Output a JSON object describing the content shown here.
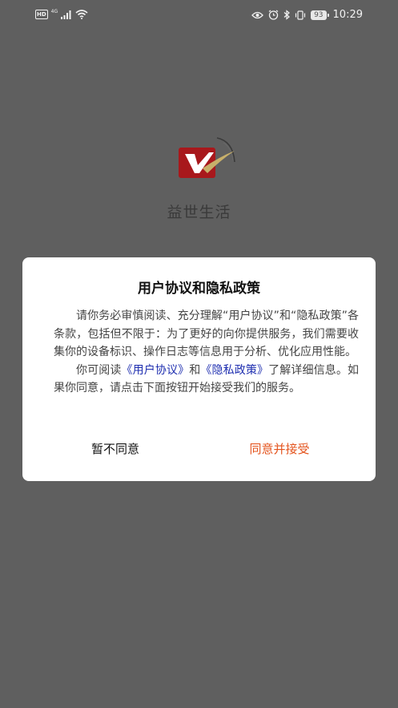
{
  "status_bar": {
    "hd": "HD",
    "network": "4G",
    "battery": "93",
    "time": "10:29"
  },
  "app": {
    "name": "益世生活",
    "logo_color": "#a8181c"
  },
  "dialog": {
    "title": "用户协议和隐私政策",
    "paragraph1": "请你务必审慎阅读、充分理解“用户协议”和“隐私政策”各条款，包括但不限于：为了更好的向你提供服务，我们需要收集你的设备标识、操作日志等信息用于分析、优化应用性能。",
    "p2_prefix": "你可阅读",
    "link_user_agreement": "《用户协议》",
    "p2_and": "和",
    "link_privacy_policy": "《隐私政策》",
    "p2_suffix": "了解详细信息。如果你同意，请点击下面按钮开始接受我们的服务。",
    "disagree_label": "暂不同意",
    "agree_label": "同意并接受",
    "agree_color": "#e4541e",
    "link_color": "#1f2fb0"
  }
}
